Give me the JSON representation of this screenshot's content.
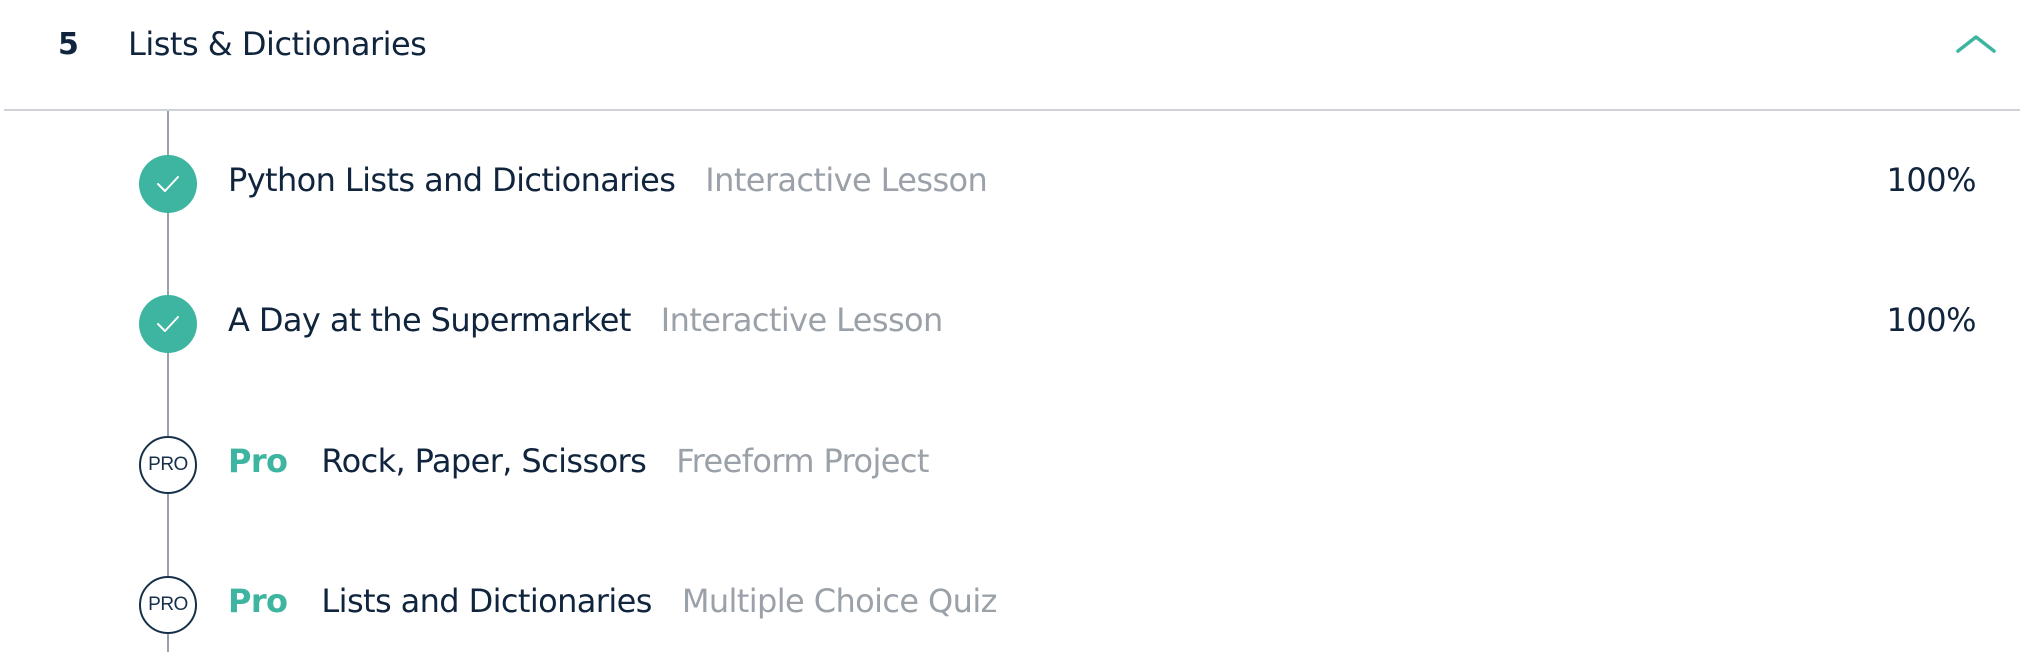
{
  "section": {
    "number": "5",
    "title": "Lists & Dictionaries",
    "toggle_icon": "chevron-up-icon"
  },
  "colors": {
    "accent": "#3db5a0",
    "text": "#10253d",
    "muted": "#9aa1a8",
    "divider": "#cfd3d7"
  },
  "lessons": [
    {
      "title": "Python Lists and Dictionaries",
      "type": "Interactive Lesson",
      "progress": "100%",
      "status": "completed",
      "status_icon": "checkmark-icon"
    },
    {
      "title": "A Day at the Supermarket",
      "type": "Interactive Lesson",
      "progress": "100%",
      "status": "completed",
      "status_icon": "checkmark-icon"
    },
    {
      "tag": "Pro",
      "badge": "PRO",
      "title": "Rock, Paper, Scissors",
      "type": "Freeform Project",
      "status": "pro-locked",
      "status_icon": "pro-badge-icon"
    },
    {
      "tag": "Pro",
      "badge": "PRO",
      "title": "Lists and Dictionaries",
      "type": "Multiple Choice Quiz",
      "status": "pro-locked",
      "status_icon": "pro-badge-icon"
    }
  ]
}
